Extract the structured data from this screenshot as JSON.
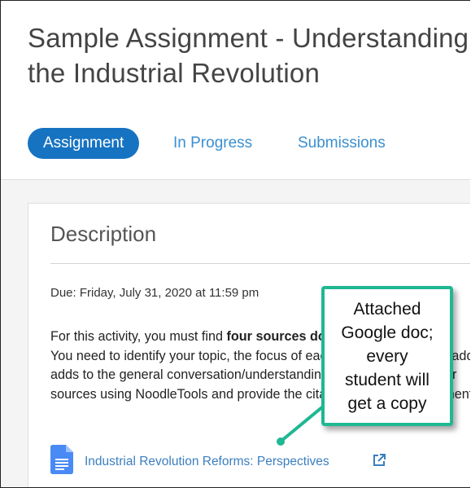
{
  "title": "Sample Assignment - Understanding\nthe Industrial Revolution",
  "tabs": [
    {
      "label": "Assignment",
      "active": true
    },
    {
      "label": "In Progress",
      "active": false
    },
    {
      "label": "Submissions",
      "active": false
    }
  ],
  "card": {
    "heading": "Description",
    "due": "Due: Friday, July 31, 2020 at 11:59 pm",
    "body_lines": [
      {
        "pre": "For this activity, you must find ",
        "bold": "four sources documentati",
        "post": ""
      },
      {
        "pre": "You need to identify your topic, the focus of each source, and what it adds to",
        "bold": "",
        "post": ""
      },
      {
        "pre": "adds to the general conversation/understanding of the topic. Cite your",
        "bold": "",
        "post": ""
      },
      {
        "pre": "sources using NoodleTools and provide the citation with your attachment.",
        "bold": "",
        "post": ""
      }
    ],
    "attachment": {
      "label": "Industrial Revolution Reforms: Perspectives",
      "icon": "google-doc-icon",
      "external_icon": "external-link-icon"
    }
  },
  "callout": {
    "lines": [
      "Attached",
      "Google doc;",
      "every",
      "student will",
      "get a copy"
    ],
    "color": "#1fb892"
  },
  "colors": {
    "accent": "#1673c2",
    "link": "#3a7fbf",
    "tab_inactive": "#3b8fd0"
  }
}
